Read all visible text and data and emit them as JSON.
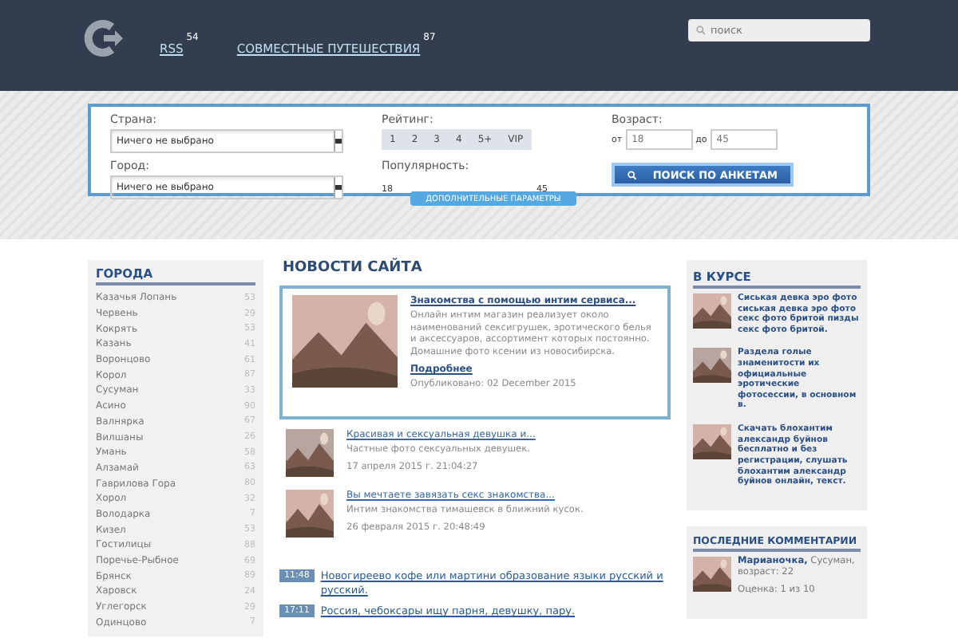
{
  "header": {
    "nav": [
      {
        "label": "RSS",
        "count": "54"
      },
      {
        "label": "СОВМЕСТНЫЕ ПУТЕШЕСТВИЯ",
        "count": "87"
      }
    ],
    "search": {
      "placeholder": "поиск"
    }
  },
  "filter": {
    "country": {
      "label": "Страна:",
      "value": "Ничего не выбрано"
    },
    "city": {
      "label": "Город:",
      "value": "Ничего не выбрано"
    },
    "rating": {
      "label": "Рейтинг:",
      "options": [
        "1",
        "2",
        "3",
        "4",
        "5+",
        "VIP"
      ]
    },
    "popularity": {
      "label": "Популярность:",
      "min": "18",
      "max": "45"
    },
    "age": {
      "label": "Возраст:",
      "from": "от",
      "from_placeholder": "18",
      "to": "до",
      "to_placeholder": "45"
    },
    "search_button": "ПОИСК ПО АНКЕТАМ",
    "more_button": "ДОПОЛНИТЕЛЬНЫЕ ПАРАМЕТРЫ"
  },
  "cities": {
    "title": "ГОРОДА",
    "items": [
      {
        "name": "Казачья Лопань",
        "count": "53"
      },
      {
        "name": "Червень",
        "count": "29"
      },
      {
        "name": "Кокрять",
        "count": "53"
      },
      {
        "name": "Казань",
        "count": "41"
      },
      {
        "name": "Воронцово",
        "count": "61"
      },
      {
        "name": "Корол",
        "count": "87"
      },
      {
        "name": "Сусуман",
        "count": "33"
      },
      {
        "name": "Асино",
        "count": "90"
      },
      {
        "name": "Валнярка",
        "count": "67"
      },
      {
        "name": "Вилшаны",
        "count": "26"
      },
      {
        "name": "Умань",
        "count": "58"
      },
      {
        "name": "Алзамай",
        "count": "63"
      },
      {
        "name": "Гаврилова Гора",
        "count": "80"
      },
      {
        "name": "Хорол",
        "count": "32"
      },
      {
        "name": "Володарка",
        "count": "7"
      },
      {
        "name": "Кизел",
        "count": "53"
      },
      {
        "name": "Гостилицы",
        "count": "88"
      },
      {
        "name": "Поречье-Рыбное",
        "count": "69"
      },
      {
        "name": "Брянск",
        "count": "89"
      },
      {
        "name": "Харовск",
        "count": "24"
      },
      {
        "name": "Углегорск",
        "count": "29"
      },
      {
        "name": "Одинцово",
        "count": "7"
      }
    ]
  },
  "news": {
    "title": "НОВОСТИ САЙТА",
    "featured": {
      "title": "Знакомства с помощью интим сервиса...",
      "text": "Онлайн интим магазин реализует около наименований сексигрушек, эротического белья и аксессуаров, ассортимент которых постоянно. Домашние фото ксении из новосибирска.",
      "more": "Подробнее",
      "published": "Опубликовано: 02 December 2015"
    },
    "items": [
      {
        "title": "Красивая и сексуальная девушка и...",
        "text": "Частные фото сексуальных девушек.",
        "date": "17 апреля 2015 г. 21:04:27"
      },
      {
        "title": "Вы мечтаете завязать секс знакомства...",
        "text": "Интим знакомства тимашевск в ближний кусок.",
        "date": "26 февраля 2015 г. 20:48:49"
      }
    ],
    "latest": [
      {
        "time": "11:48",
        "text": "Новогиреево кофе или мартини образование языки русский и русский."
      },
      {
        "time": "17:11",
        "text": "Россия, чебоксары ищу парня, девушку, пару."
      }
    ]
  },
  "aside": {
    "title": "В КУРСЕ",
    "items": [
      "Сиськая девка эро фото сиськая девка эро фото секс фото бритой пизды секс фото бритой.",
      "Раздела голые знаменитости их официальные эротические фотосессии, в основном в.",
      "Скачать блохантим александр буйнов бесплатно и без регистрации, слушать блохантим александр буйнов онлайн, текст."
    ]
  },
  "comments": {
    "title": "ПОСЛЕДНИЕ КОММЕНТАРИИ",
    "items": [
      {
        "name": "Марианочка,",
        "place": "Сусуман, возраст: 22",
        "rating": "Оценка: 1 из 10"
      }
    ]
  }
}
